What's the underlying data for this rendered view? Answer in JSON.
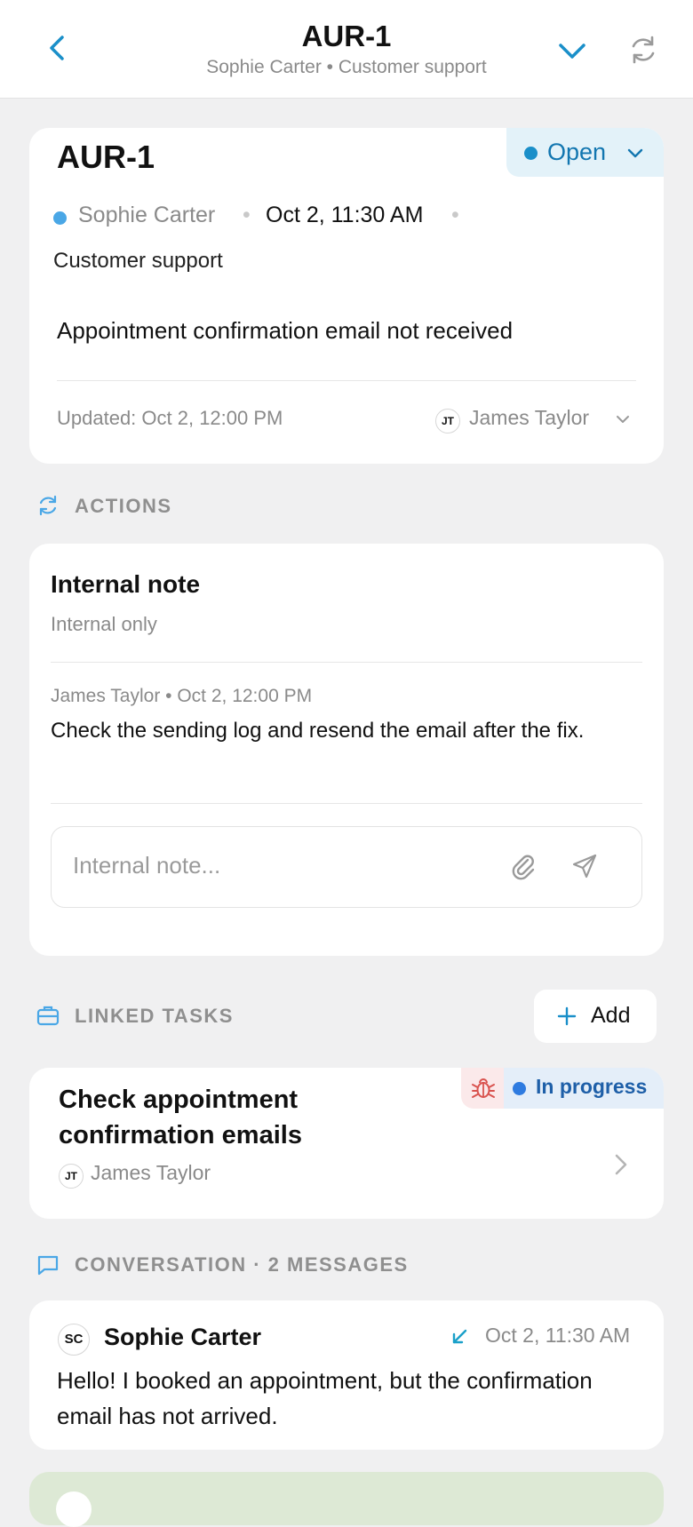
{
  "header": {
    "title": "AUR-1",
    "subtitle": "Sophie Carter • Customer support"
  },
  "ticket": {
    "id": "AUR-1",
    "status": "Open",
    "customer": "Sophie Carter",
    "separator": "•",
    "created": "Oct 2, 11:30 AM",
    "category": "Customer support",
    "subject": "Appointment confirmation email not received",
    "updated": "Updated: Oct 2, 12:00 PM",
    "assignee_initials": "JT",
    "assignee": "James Taylor"
  },
  "actions": {
    "heading": "ACTIONS",
    "note_title": "Internal note",
    "note_subtitle": "Internal only",
    "note_meta": "James Taylor • Oct 2, 12:00 PM",
    "note_body": "Check the sending log and resend the email after the fix.",
    "input_placeholder": "Internal note..."
  },
  "linked_tasks": {
    "heading": "LINKED TASKS",
    "add_label": "Add",
    "task": {
      "title": "Check appointment confirmation emails",
      "status": "In progress",
      "assignee_initials": "JT",
      "assignee": "James Taylor"
    }
  },
  "conversation": {
    "heading": "CONVERSATION · 2 MESSAGES",
    "message": {
      "initials": "SC",
      "sender": "Sophie Carter",
      "time": "Oct 2, 11:30 AM",
      "body": "Hello! I booked an appointment, but the confirmation email has not arrived."
    }
  },
  "colors": {
    "accent": "#1a8fc9",
    "open_pill": "#e3f2f9",
    "progress_pill": "#e4eef9",
    "bug_pill": "#fbe9ea",
    "background": "#f0f0f1"
  }
}
